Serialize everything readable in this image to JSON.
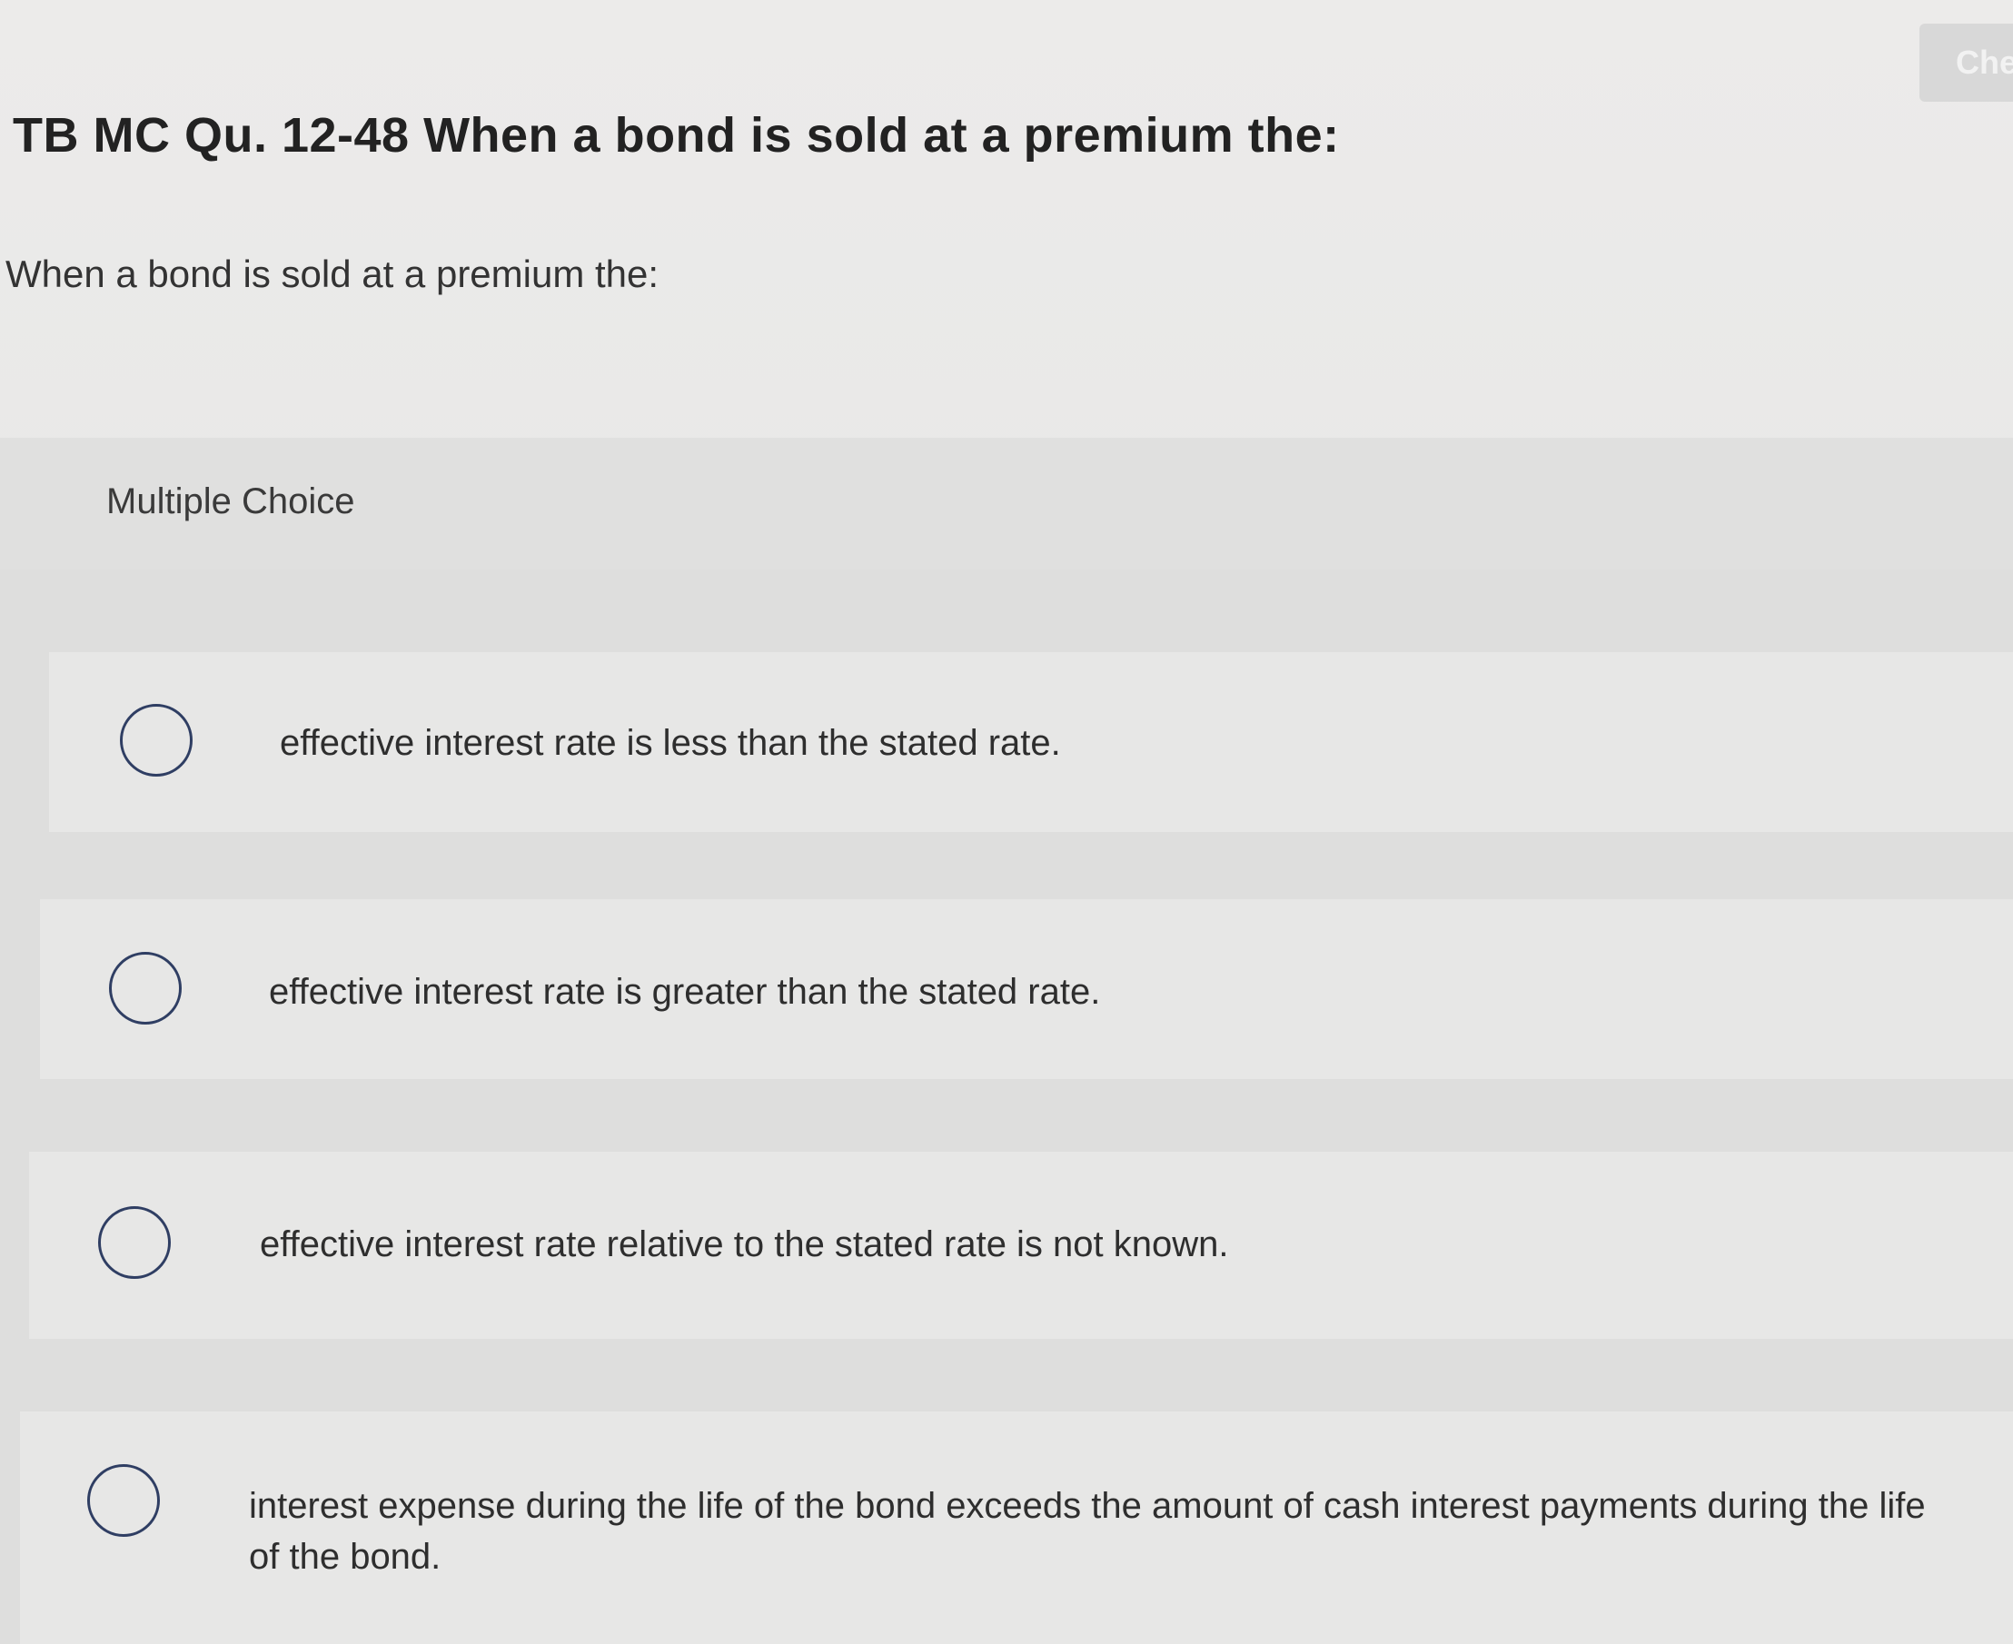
{
  "header": {
    "check_button_label": "Che"
  },
  "question": {
    "title": "TB MC Qu. 12-48 When a bond is sold at a premium the:",
    "prompt": "When a bond is sold at a premium the:",
    "type_label": "Multiple Choice"
  },
  "options": [
    {
      "text": "effective interest rate is less than the stated rate."
    },
    {
      "text": "effective interest rate is greater than the stated rate."
    },
    {
      "text": "effective interest rate relative to the stated rate is not known."
    },
    {
      "text": "interest expense during the life of the bond exceeds the amount of cash interest payments during the life of the bond."
    }
  ],
  "icons": {
    "radio": "radio-unselected-icon"
  }
}
